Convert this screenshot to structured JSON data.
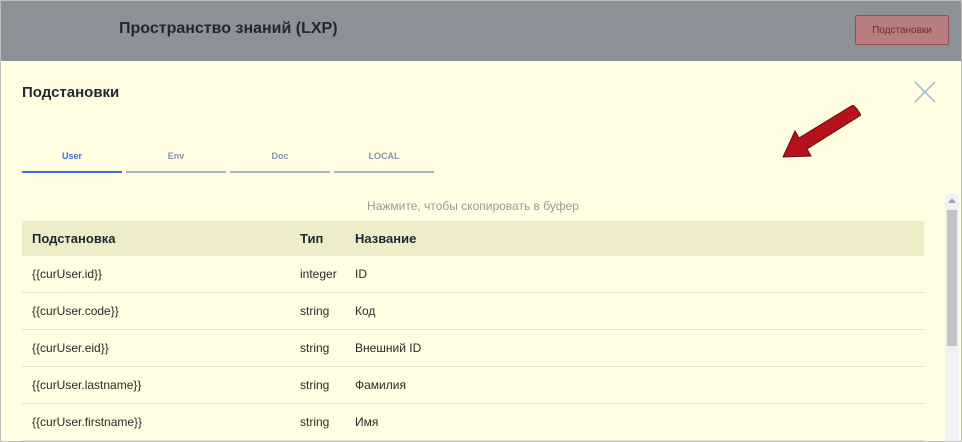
{
  "header": {
    "app_title": "Пространство знаний (LXP)",
    "substitutions_button": "Подстановки"
  },
  "modal": {
    "title": "Подстановки",
    "close_icon": "close-icon",
    "pointer_icon": "red-arrow-icon",
    "tabs": [
      {
        "label": "User",
        "active": true
      },
      {
        "label": "Env",
        "active": false
      },
      {
        "label": "Doc",
        "active": false
      },
      {
        "label": "LOCAL",
        "active": false
      }
    ],
    "hint": "Нажмите, чтобы скопировать в буфер",
    "table": {
      "columns": [
        "Подстановка",
        "Тип",
        "Название"
      ],
      "rows": [
        [
          "{{curUser.id}}",
          "integer",
          "ID"
        ],
        [
          "{{curUser.code}}",
          "string",
          "Код"
        ],
        [
          "{{curUser.eid}}",
          "string",
          "Внешний ID"
        ],
        [
          "{{curUser.lastname}}",
          "string",
          "Фамилия"
        ],
        [
          "{{curUser.firstname}}",
          "string",
          "Имя"
        ]
      ]
    }
  },
  "colors": {
    "topbar": "#8c9097",
    "modal_bg": "#fffde2",
    "active_tab": "#3f6fe0",
    "arrow": "#b5121b"
  }
}
